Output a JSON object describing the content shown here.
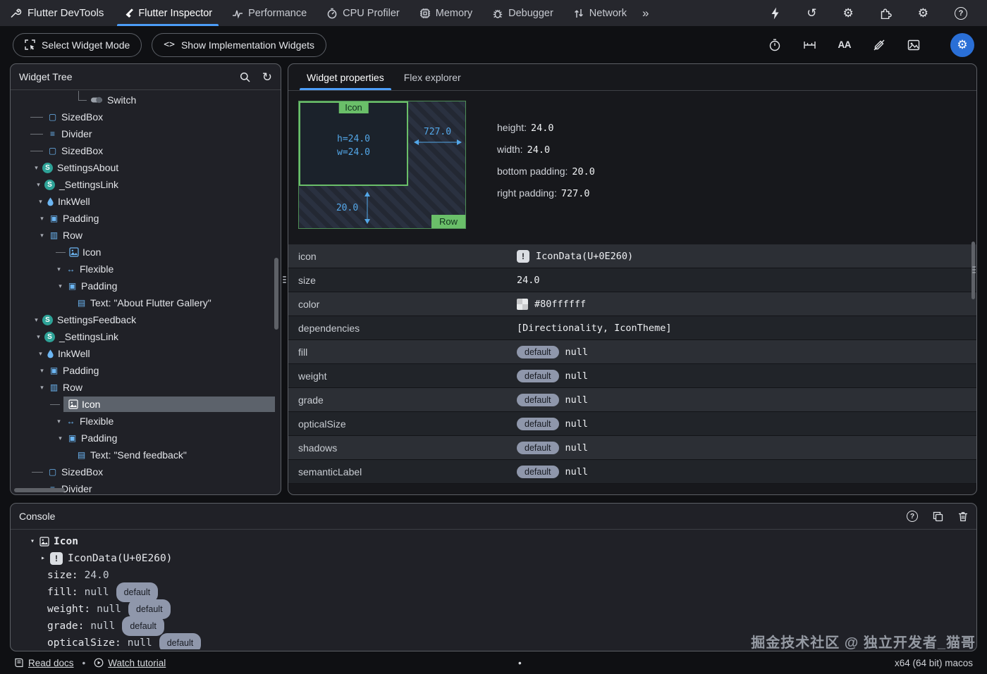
{
  "top_nav": {
    "brand": "Flutter DevTools",
    "tabs": [
      {
        "label": "Flutter Inspector",
        "active": true
      },
      {
        "label": "Performance",
        "active": false
      },
      {
        "label": "CPU Profiler",
        "active": false
      },
      {
        "label": "Memory",
        "active": false
      },
      {
        "label": "Debugger",
        "active": false
      },
      {
        "label": "Network",
        "active": false
      }
    ],
    "overflow_icon": "»"
  },
  "toolbar": {
    "select_widget_mode_label": "Select Widget Mode",
    "show_implementation_label": "Show Implementation Widgets"
  },
  "widget_tree": {
    "title": "Widget Tree",
    "items": [
      {
        "label": "Switch"
      },
      {
        "label": "SizedBox"
      },
      {
        "label": "Divider"
      },
      {
        "label": "SizedBox"
      },
      {
        "label": "SettingsAbout"
      },
      {
        "label": "_SettingsLink"
      },
      {
        "label": "InkWell"
      },
      {
        "label": "Padding"
      },
      {
        "label": "Row"
      },
      {
        "label": "Icon"
      },
      {
        "label": "Flexible"
      },
      {
        "label": "Padding"
      },
      {
        "label": "Text: \"About Flutter Gallery\""
      },
      {
        "label": "SettingsFeedback"
      },
      {
        "label": "_SettingsLink"
      },
      {
        "label": "InkWell"
      },
      {
        "label": "Padding"
      },
      {
        "label": "Row"
      },
      {
        "label": "Icon",
        "selected": true
      },
      {
        "label": "Flexible"
      },
      {
        "label": "Padding"
      },
      {
        "label": "Text: \"Send feedback\""
      },
      {
        "label": "SizedBox"
      },
      {
        "label": "Divider"
      }
    ]
  },
  "properties_panel": {
    "tabs": [
      {
        "label": "Widget properties",
        "active": true
      },
      {
        "label": "Flex explorer",
        "active": false
      }
    ],
    "layout_explorer": {
      "widget_label": "Icon",
      "parent_label": "Row",
      "height_line": "h=24.0",
      "width_line": "w=24.0",
      "right_padding": "727.0",
      "bottom_padding": "20.0"
    },
    "summary": [
      {
        "label": "height:",
        "value": "24.0"
      },
      {
        "label": "width:",
        "value": "24.0"
      },
      {
        "label": "bottom padding:",
        "value": "20.0"
      },
      {
        "label": "right padding:",
        "value": "727.0"
      }
    ],
    "rows": [
      {
        "label": "icon",
        "value": "IconData(U+0E260)"
      },
      {
        "label": "size",
        "value": "24.0"
      },
      {
        "label": "color",
        "value": "#80ffffff"
      },
      {
        "label": "dependencies",
        "value": "[Directionality, IconTheme]"
      },
      {
        "label": "fill",
        "badge": "default",
        "value": "null"
      },
      {
        "label": "weight",
        "badge": "default",
        "value": "null"
      },
      {
        "label": "grade",
        "badge": "default",
        "value": "null"
      },
      {
        "label": "opticalSize",
        "badge": "default",
        "value": "null"
      },
      {
        "label": "shadows",
        "badge": "default",
        "value": "null"
      },
      {
        "label": "semanticLabel",
        "badge": "default",
        "value": "null"
      }
    ]
  },
  "console": {
    "title": "Console",
    "lines": [
      {
        "text": "Icon"
      },
      {
        "text": "IconData(U+0E260)"
      },
      {
        "label": "size:",
        "value": "24.0"
      },
      {
        "label": "fill:",
        "value": "null",
        "badge": "default"
      },
      {
        "label": "weight:",
        "value": "null",
        "badge": "default"
      },
      {
        "label": "grade:",
        "value": "null",
        "badge": "default"
      },
      {
        "label": "opticalSize:",
        "value": "null",
        "badge": "default"
      }
    ]
  },
  "status_bar": {
    "read_docs": "Read docs",
    "watch_tutorial": "Watch tutorial",
    "separator": "•",
    "platform": "x64 (64 bit) macos"
  },
  "watermark": "掘金技术社区 @ 独立开发者_猫哥",
  "icons": {
    "overflow": "»",
    "gear": "⚙",
    "history": "↺",
    "refresh": "↻",
    "help": "?",
    "chevron_expanded": "▾",
    "chevron_collapsed": "▸",
    "sizedbox": "▢",
    "divider": "≡",
    "padding": "▣",
    "row": "▥",
    "text": "▤",
    "flexible": "↔",
    "settings_badge": "S",
    "code": "<>",
    "baselines": "AA",
    "icon_preview": "!"
  },
  "colors": {
    "accent_blue": "#4c9df8",
    "layout_green": "#6abf69",
    "dimension_blue": "#53a7e8",
    "badge_bg": "#8f97ab",
    "selected_row_bg": "#5c626b",
    "settings_badge_teal": "#2ea297",
    "color_value_hex": "#80ffffff"
  }
}
